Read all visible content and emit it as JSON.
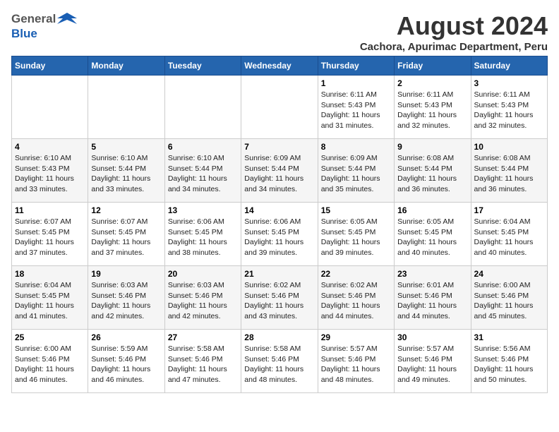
{
  "header": {
    "logo_general": "General",
    "logo_blue": "Blue",
    "title": "August 2024",
    "subtitle": "Cachora, Apurimac Department, Peru"
  },
  "days_of_week": [
    "Sunday",
    "Monday",
    "Tuesday",
    "Wednesday",
    "Thursday",
    "Friday",
    "Saturday"
  ],
  "weeks": [
    [
      {
        "day": "",
        "detail": ""
      },
      {
        "day": "",
        "detail": ""
      },
      {
        "day": "",
        "detail": ""
      },
      {
        "day": "",
        "detail": ""
      },
      {
        "day": "1",
        "detail": "Sunrise: 6:11 AM\nSunset: 5:43 PM\nDaylight: 11 hours\nand 31 minutes."
      },
      {
        "day": "2",
        "detail": "Sunrise: 6:11 AM\nSunset: 5:43 PM\nDaylight: 11 hours\nand 32 minutes."
      },
      {
        "day": "3",
        "detail": "Sunrise: 6:11 AM\nSunset: 5:43 PM\nDaylight: 11 hours\nand 32 minutes."
      }
    ],
    [
      {
        "day": "4",
        "detail": "Sunrise: 6:10 AM\nSunset: 5:43 PM\nDaylight: 11 hours\nand 33 minutes."
      },
      {
        "day": "5",
        "detail": "Sunrise: 6:10 AM\nSunset: 5:44 PM\nDaylight: 11 hours\nand 33 minutes."
      },
      {
        "day": "6",
        "detail": "Sunrise: 6:10 AM\nSunset: 5:44 PM\nDaylight: 11 hours\nand 34 minutes."
      },
      {
        "day": "7",
        "detail": "Sunrise: 6:09 AM\nSunset: 5:44 PM\nDaylight: 11 hours\nand 34 minutes."
      },
      {
        "day": "8",
        "detail": "Sunrise: 6:09 AM\nSunset: 5:44 PM\nDaylight: 11 hours\nand 35 minutes."
      },
      {
        "day": "9",
        "detail": "Sunrise: 6:08 AM\nSunset: 5:44 PM\nDaylight: 11 hours\nand 36 minutes."
      },
      {
        "day": "10",
        "detail": "Sunrise: 6:08 AM\nSunset: 5:44 PM\nDaylight: 11 hours\nand 36 minutes."
      }
    ],
    [
      {
        "day": "11",
        "detail": "Sunrise: 6:07 AM\nSunset: 5:45 PM\nDaylight: 11 hours\nand 37 minutes."
      },
      {
        "day": "12",
        "detail": "Sunrise: 6:07 AM\nSunset: 5:45 PM\nDaylight: 11 hours\nand 37 minutes."
      },
      {
        "day": "13",
        "detail": "Sunrise: 6:06 AM\nSunset: 5:45 PM\nDaylight: 11 hours\nand 38 minutes."
      },
      {
        "day": "14",
        "detail": "Sunrise: 6:06 AM\nSunset: 5:45 PM\nDaylight: 11 hours\nand 39 minutes."
      },
      {
        "day": "15",
        "detail": "Sunrise: 6:05 AM\nSunset: 5:45 PM\nDaylight: 11 hours\nand 39 minutes."
      },
      {
        "day": "16",
        "detail": "Sunrise: 6:05 AM\nSunset: 5:45 PM\nDaylight: 11 hours\nand 40 minutes."
      },
      {
        "day": "17",
        "detail": "Sunrise: 6:04 AM\nSunset: 5:45 PM\nDaylight: 11 hours\nand 40 minutes."
      }
    ],
    [
      {
        "day": "18",
        "detail": "Sunrise: 6:04 AM\nSunset: 5:45 PM\nDaylight: 11 hours\nand 41 minutes."
      },
      {
        "day": "19",
        "detail": "Sunrise: 6:03 AM\nSunset: 5:46 PM\nDaylight: 11 hours\nand 42 minutes."
      },
      {
        "day": "20",
        "detail": "Sunrise: 6:03 AM\nSunset: 5:46 PM\nDaylight: 11 hours\nand 42 minutes."
      },
      {
        "day": "21",
        "detail": "Sunrise: 6:02 AM\nSunset: 5:46 PM\nDaylight: 11 hours\nand 43 minutes."
      },
      {
        "day": "22",
        "detail": "Sunrise: 6:02 AM\nSunset: 5:46 PM\nDaylight: 11 hours\nand 44 minutes."
      },
      {
        "day": "23",
        "detail": "Sunrise: 6:01 AM\nSunset: 5:46 PM\nDaylight: 11 hours\nand 44 minutes."
      },
      {
        "day": "24",
        "detail": "Sunrise: 6:00 AM\nSunset: 5:46 PM\nDaylight: 11 hours\nand 45 minutes."
      }
    ],
    [
      {
        "day": "25",
        "detail": "Sunrise: 6:00 AM\nSunset: 5:46 PM\nDaylight: 11 hours\nand 46 minutes."
      },
      {
        "day": "26",
        "detail": "Sunrise: 5:59 AM\nSunset: 5:46 PM\nDaylight: 11 hours\nand 46 minutes."
      },
      {
        "day": "27",
        "detail": "Sunrise: 5:58 AM\nSunset: 5:46 PM\nDaylight: 11 hours\nand 47 minutes."
      },
      {
        "day": "28",
        "detail": "Sunrise: 5:58 AM\nSunset: 5:46 PM\nDaylight: 11 hours\nand 48 minutes."
      },
      {
        "day": "29",
        "detail": "Sunrise: 5:57 AM\nSunset: 5:46 PM\nDaylight: 11 hours\nand 48 minutes."
      },
      {
        "day": "30",
        "detail": "Sunrise: 5:57 AM\nSunset: 5:46 PM\nDaylight: 11 hours\nand 49 minutes."
      },
      {
        "day": "31",
        "detail": "Sunrise: 5:56 AM\nSunset: 5:46 PM\nDaylight: 11 hours\nand 50 minutes."
      }
    ]
  ]
}
